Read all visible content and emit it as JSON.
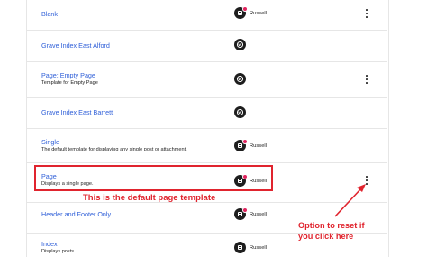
{
  "templates": [
    {
      "title": "Blank",
      "description": "",
      "author": "Russell",
      "author_icon": "template-icon",
      "has_dot": true
    },
    {
      "title": "Grave Index East Alford",
      "description": "",
      "author": "",
      "author_icon": "wordpress-icon",
      "has_dot": false
    },
    {
      "title": "Page: Empty Page",
      "description": "Template for Empty Page",
      "author": "",
      "author_icon": "wordpress-icon",
      "has_dot": false
    },
    {
      "title": "Grave Index East Barrett",
      "description": "",
      "author": "",
      "author_icon": "wordpress-icon",
      "has_dot": false
    },
    {
      "title": "Single",
      "description": "The default template for displaying any single post or attachment.",
      "author": "Russell",
      "author_icon": "template-icon",
      "has_dot": true
    },
    {
      "title": "Page",
      "description": "Displays a single page.",
      "author": "Russell",
      "author_icon": "template-icon",
      "has_dot": true
    },
    {
      "title": "Header and Footer Only",
      "description": "",
      "author": "Russell",
      "author_icon": "template-icon",
      "has_dot": true
    },
    {
      "title": "Index",
      "description": "Displays posts.",
      "author": "Russell",
      "author_icon": "template-icon",
      "has_dot": false
    }
  ],
  "annotations": {
    "highlight_label": "This is the default page template",
    "reset_label_line1": "Option to reset if",
    "reset_label_line2": "you click here",
    "color": "#e0242e"
  },
  "colors": {
    "link": "#2f5fd8",
    "text": "#1e1e1e",
    "divider": "#e6e6e6",
    "badge_dot": "#e0245e"
  }
}
